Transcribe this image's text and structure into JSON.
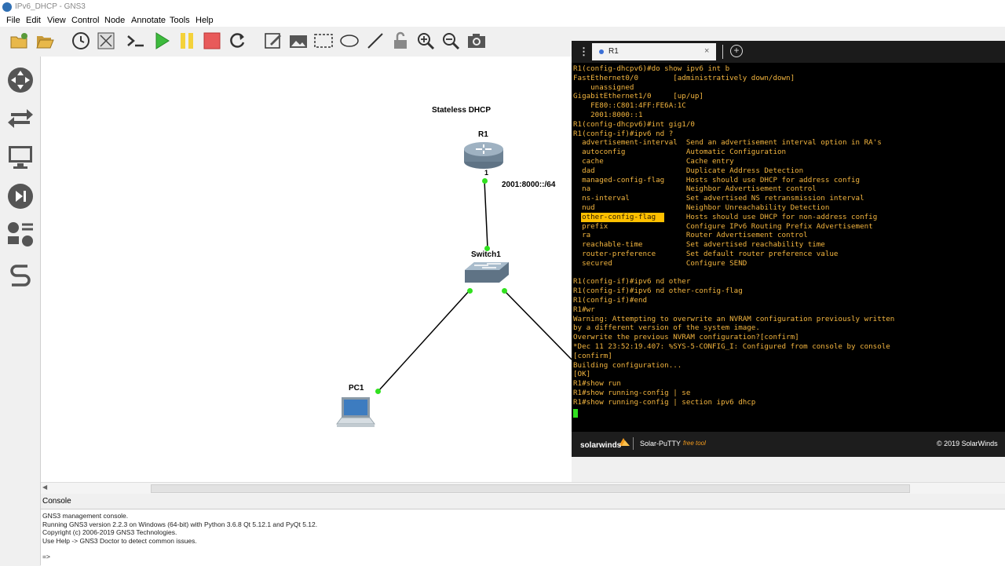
{
  "window": {
    "title": "IPv6_DHCP - GNS3"
  },
  "menu": [
    "File",
    "Edit",
    "View",
    "Control",
    "Node",
    "Annotate",
    "Tools",
    "Help"
  ],
  "topology": {
    "title": "Stateless DHCP",
    "nodes": {
      "router": "R1",
      "switch": "Switch1",
      "pc": "PC1"
    },
    "link_label": "2001:8000::/64",
    "port_label": "1"
  },
  "putty": {
    "tab_label": "R1",
    "brand": "solarwinds",
    "product": "Solar-PuTTY",
    "product_tag": "free tool",
    "copyright": "© 2019 SolarWinds",
    "highlight_color": "#ffc000",
    "text_color": "#f3b53f",
    "lines": [
      "R1(config-dhcpv6)#do show ipv6 int b",
      "FastEthernet0/0        [administratively down/down]",
      "    unassigned",
      "GigabitEthernet1/0     [up/up]",
      "    FE80::C801:4FF:FE6A:1C",
      "    2001:8000::1",
      "R1(config-dhcpv6)#int gig1/0",
      "R1(config-if)#ipv6 nd ?",
      "  advertisement-interval  Send an advertisement interval option in RA's",
      "  autoconfig              Automatic Configuration",
      "  cache                   Cache entry",
      "  dad                     Duplicate Address Detection",
      "  managed-config-flag     Hosts should use DHCP for address config",
      "  na                      Neighbor Advertisement control",
      "  ns-interval             Set advertised NS retransmission interval",
      "  nud                     Neighbor Unreachability Detection",
      "  other-config-flag       Hosts should use DHCP for non-address config",
      "  prefix                  Configure IPv6 Routing Prefix Advertisement",
      "  ra                      Router Advertisement control",
      "  reachable-time          Set advertised reachability time",
      "  router-preference       Set default router preference value",
      "  secured                 Configure SEND",
      "",
      "R1(config-if)#ipv6 nd other",
      "R1(config-if)#ipv6 nd other-config-flag",
      "R1(config-if)#end",
      "R1#wr",
      "Warning: Attempting to overwrite an NVRAM configuration previously written",
      "by a different version of the system image.",
      "Overwrite the previous NVRAM configuration?[confirm]",
      "*Dec 11 23:52:19.407: %SYS-5-CONFIG_I: Configured from console by console",
      "[confirm]",
      "Building configuration...",
      "[OK]",
      "R1#show run",
      "R1#show running-config | se",
      "R1#show running-config | section ipv6 dhcp"
    ],
    "highlighted_option": "other-config-flag"
  },
  "console": {
    "title": "Console",
    "lines": [
      "GNS3 management console.",
      "Running GNS3 version 2.2.3 on Windows (64-bit) with Python 3.6.8 Qt 5.12.1 and PyQt 5.12.",
      "Copyright (c) 2006-2019 GNS3 Technologies.",
      "Use Help -> GNS3 Doctor to detect common issues."
    ],
    "prompt": "=>"
  }
}
